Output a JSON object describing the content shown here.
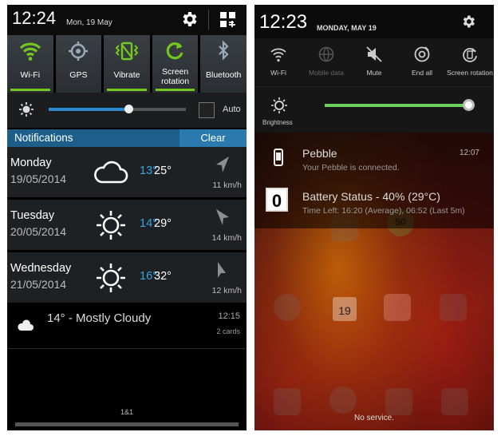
{
  "left": {
    "status": {
      "time": "12:24",
      "date": "Mon, 19 May"
    },
    "toggles": [
      {
        "label": "Wi-Fi",
        "icon": "wifi-icon",
        "active": true
      },
      {
        "label": "GPS",
        "icon": "gps-icon",
        "active": false
      },
      {
        "label": "Vibrate",
        "icon": "vibrate-icon",
        "active": true
      },
      {
        "label": "Screen\nrotation",
        "icon": "screen-rotation-icon",
        "active": true
      },
      {
        "label": "Bluetooth",
        "icon": "bluetooth-icon",
        "active": false
      }
    ],
    "brightness": {
      "level": 0.58,
      "auto_label": "Auto"
    },
    "notifications": {
      "title": "Notifications",
      "clear_label": "Clear"
    },
    "forecast": [
      {
        "day": "Monday",
        "date": "19/05/2014",
        "icon": "cloud-icon",
        "low": "13°",
        "high": "25°",
        "wind": "11 km/h"
      },
      {
        "day": "Tuesday",
        "date": "20/05/2014",
        "icon": "sun-icon",
        "low": "14°",
        "high": "29°",
        "wind": "14 km/h"
      },
      {
        "day": "Wednesday",
        "date": "21/05/2014",
        "icon": "sun-icon",
        "low": "16°",
        "high": "32°",
        "wind": "12 km/h"
      }
    ],
    "current": {
      "text": "14° - Mostly Cloudy",
      "time": "12:15",
      "cards": "2 cards"
    },
    "carrier": "1&1"
  },
  "right": {
    "status": {
      "time": "12:23",
      "date": "MONDAY, MAY 19"
    },
    "toggles": [
      {
        "label": "Wi-Fi",
        "icon": "wifi-icon",
        "enabled": true
      },
      {
        "label": "Mobile data",
        "icon": "mobile-data-icon",
        "enabled": false
      },
      {
        "label": "Mute",
        "icon": "mute-icon",
        "enabled": true
      },
      {
        "label": "End all",
        "icon": "end-all-icon",
        "enabled": true
      },
      {
        "label": "Screen rotation",
        "icon": "screen-rotation-icon",
        "enabled": true
      }
    ],
    "brightness": {
      "label": "Brightness",
      "level": 1.0
    },
    "notifications": [
      {
        "title": "Pebble",
        "subtitle": "Your Pebble is connected.",
        "time": "12:07"
      },
      {
        "title": "Battery Status - 40% (29°C)",
        "subtitle": "Time Left: 16:20 (Average), 06:52 (Last 5m)",
        "badge": "0"
      }
    ],
    "homescreen": {
      "calendar_day": "19",
      "badge_number": "50"
    },
    "no_service": "No service."
  },
  "colors": {
    "accent_green": "#72c81e",
    "accent_blue": "#2a8bd4",
    "temp_low": "#3aa2e0",
    "right_slider": "#6ad05a"
  }
}
